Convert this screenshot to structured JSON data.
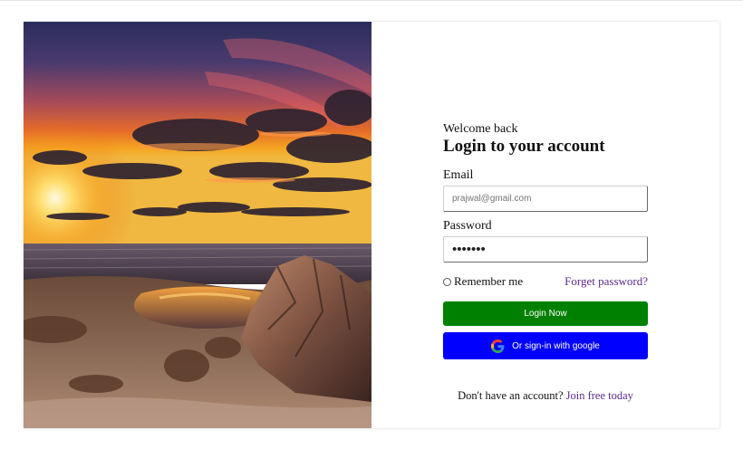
{
  "login": {
    "welcome": "Welcome back",
    "heading": "Login to your account",
    "email_label": "Email",
    "email_placeholder": "prajwal@gmail.com",
    "password_label": "Password",
    "password_value": "•••••••",
    "remember_label": "Remember me",
    "forgot_label": "Forget password?",
    "login_button": "Login Now",
    "google_button": "Or sign-in with google",
    "signup_prefix": "Don't have an account?",
    "signup_link": "Join free today"
  },
  "colors": {
    "login_button_bg": "#008000",
    "google_button_bg": "#0000ff",
    "link": "#5d2a8a"
  },
  "icons": {
    "google": "google-g-icon",
    "radio": "radio-unchecked-icon"
  },
  "hero": {
    "description_icon": "sunset-beach-photo"
  }
}
